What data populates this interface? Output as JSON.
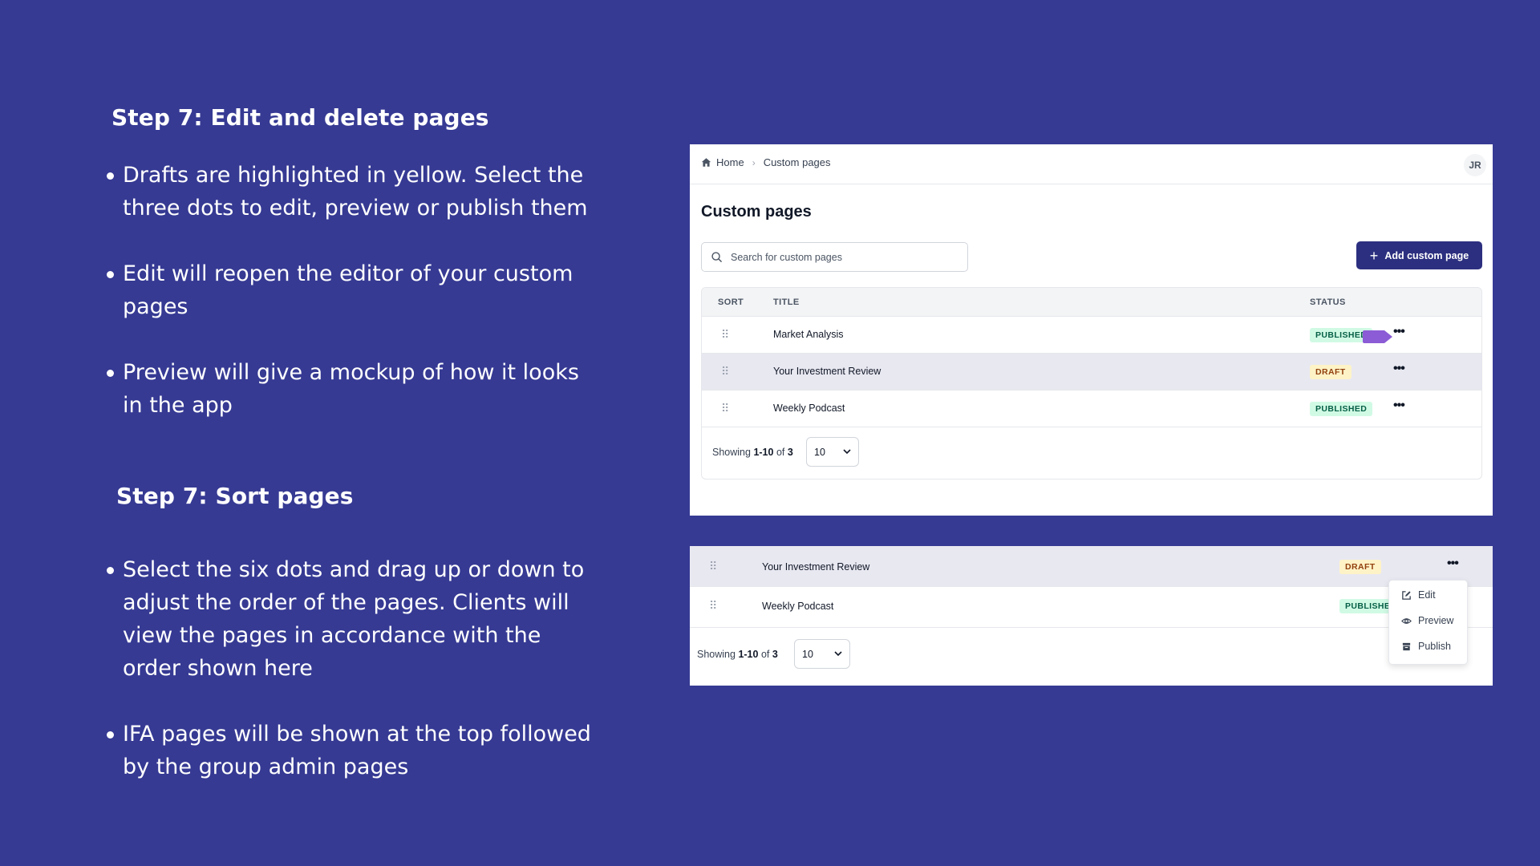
{
  "section1": {
    "heading": "Step 7: Edit and delete pages",
    "bullets": [
      "Drafts are highlighted in yellow. Select the three dots to edit, preview or publish them",
      "Edit will reopen the editor of your custom pages",
      "Preview will give a mockup of how it looks in the app"
    ]
  },
  "section2": {
    "heading": "Step 7: Sort pages",
    "bullets": [
      "Select the six dots and drag up or down to adjust the order of the pages. Clients will view the pages in accordance with the order shown here",
      "IFA pages will be shown at the top followed by the group admin pages"
    ]
  },
  "screenshot1": {
    "breadcrumb": {
      "home": "Home",
      "current": "Custom pages"
    },
    "avatar": "JR",
    "title": "Custom pages",
    "search_placeholder": "Search for custom pages",
    "add_button": "Add custom page",
    "columns": {
      "sort": "SORT",
      "title": "TITLE",
      "status": "STATUS"
    },
    "rows": [
      {
        "title": "Market Analysis",
        "status": "PUBLISHED"
      },
      {
        "title": "Your Investment Review",
        "status": "DRAFT"
      },
      {
        "title": "Weekly Podcast",
        "status": "PUBLISHED"
      }
    ],
    "footer": {
      "showing": "Showing",
      "range": "1-10",
      "of": "of",
      "total": "3",
      "per_page": "10"
    }
  },
  "screenshot2": {
    "rows": [
      {
        "title": "Your Investment Review",
        "status": "DRAFT"
      },
      {
        "title": "Weekly Podcast",
        "status": "PUBLISHE"
      }
    ],
    "menu": {
      "edit": "Edit",
      "preview": "Preview",
      "publish": "Publish"
    },
    "footer": {
      "showing": "Showing",
      "range": "1-10",
      "of": "of",
      "total": "3",
      "per_page": "10"
    }
  },
  "colors": {
    "background": "#363a93",
    "button": "#2c2f7f",
    "published_badge": "#d1fae5",
    "draft_badge": "#fef3c7",
    "highlight_row": "#e8e8f1",
    "arrow_tag": "#8b5cd6"
  },
  "icons": [
    "home-icon",
    "chevron-right-icon",
    "search-icon",
    "plus-icon",
    "drag-handle-icon",
    "more-dots-icon",
    "chevron-down-icon",
    "edit-icon",
    "eye-icon",
    "publish-icon",
    "arrow-tag-icon"
  ]
}
